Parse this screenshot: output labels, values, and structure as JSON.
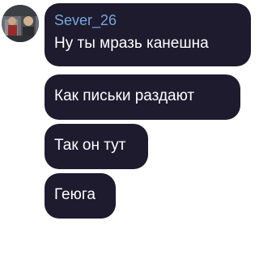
{
  "sender": {
    "name": "Sever_26",
    "avatar_icon": "user-avatar-photo",
    "name_color": "#78a6d8"
  },
  "bubble_color": "#1e1b2e",
  "messages": [
    {
      "text": "Ну ты мразь канешна"
    },
    {
      "text": "Как письки раздают"
    },
    {
      "text": "Так он тут"
    },
    {
      "text": "Геюга"
    }
  ]
}
